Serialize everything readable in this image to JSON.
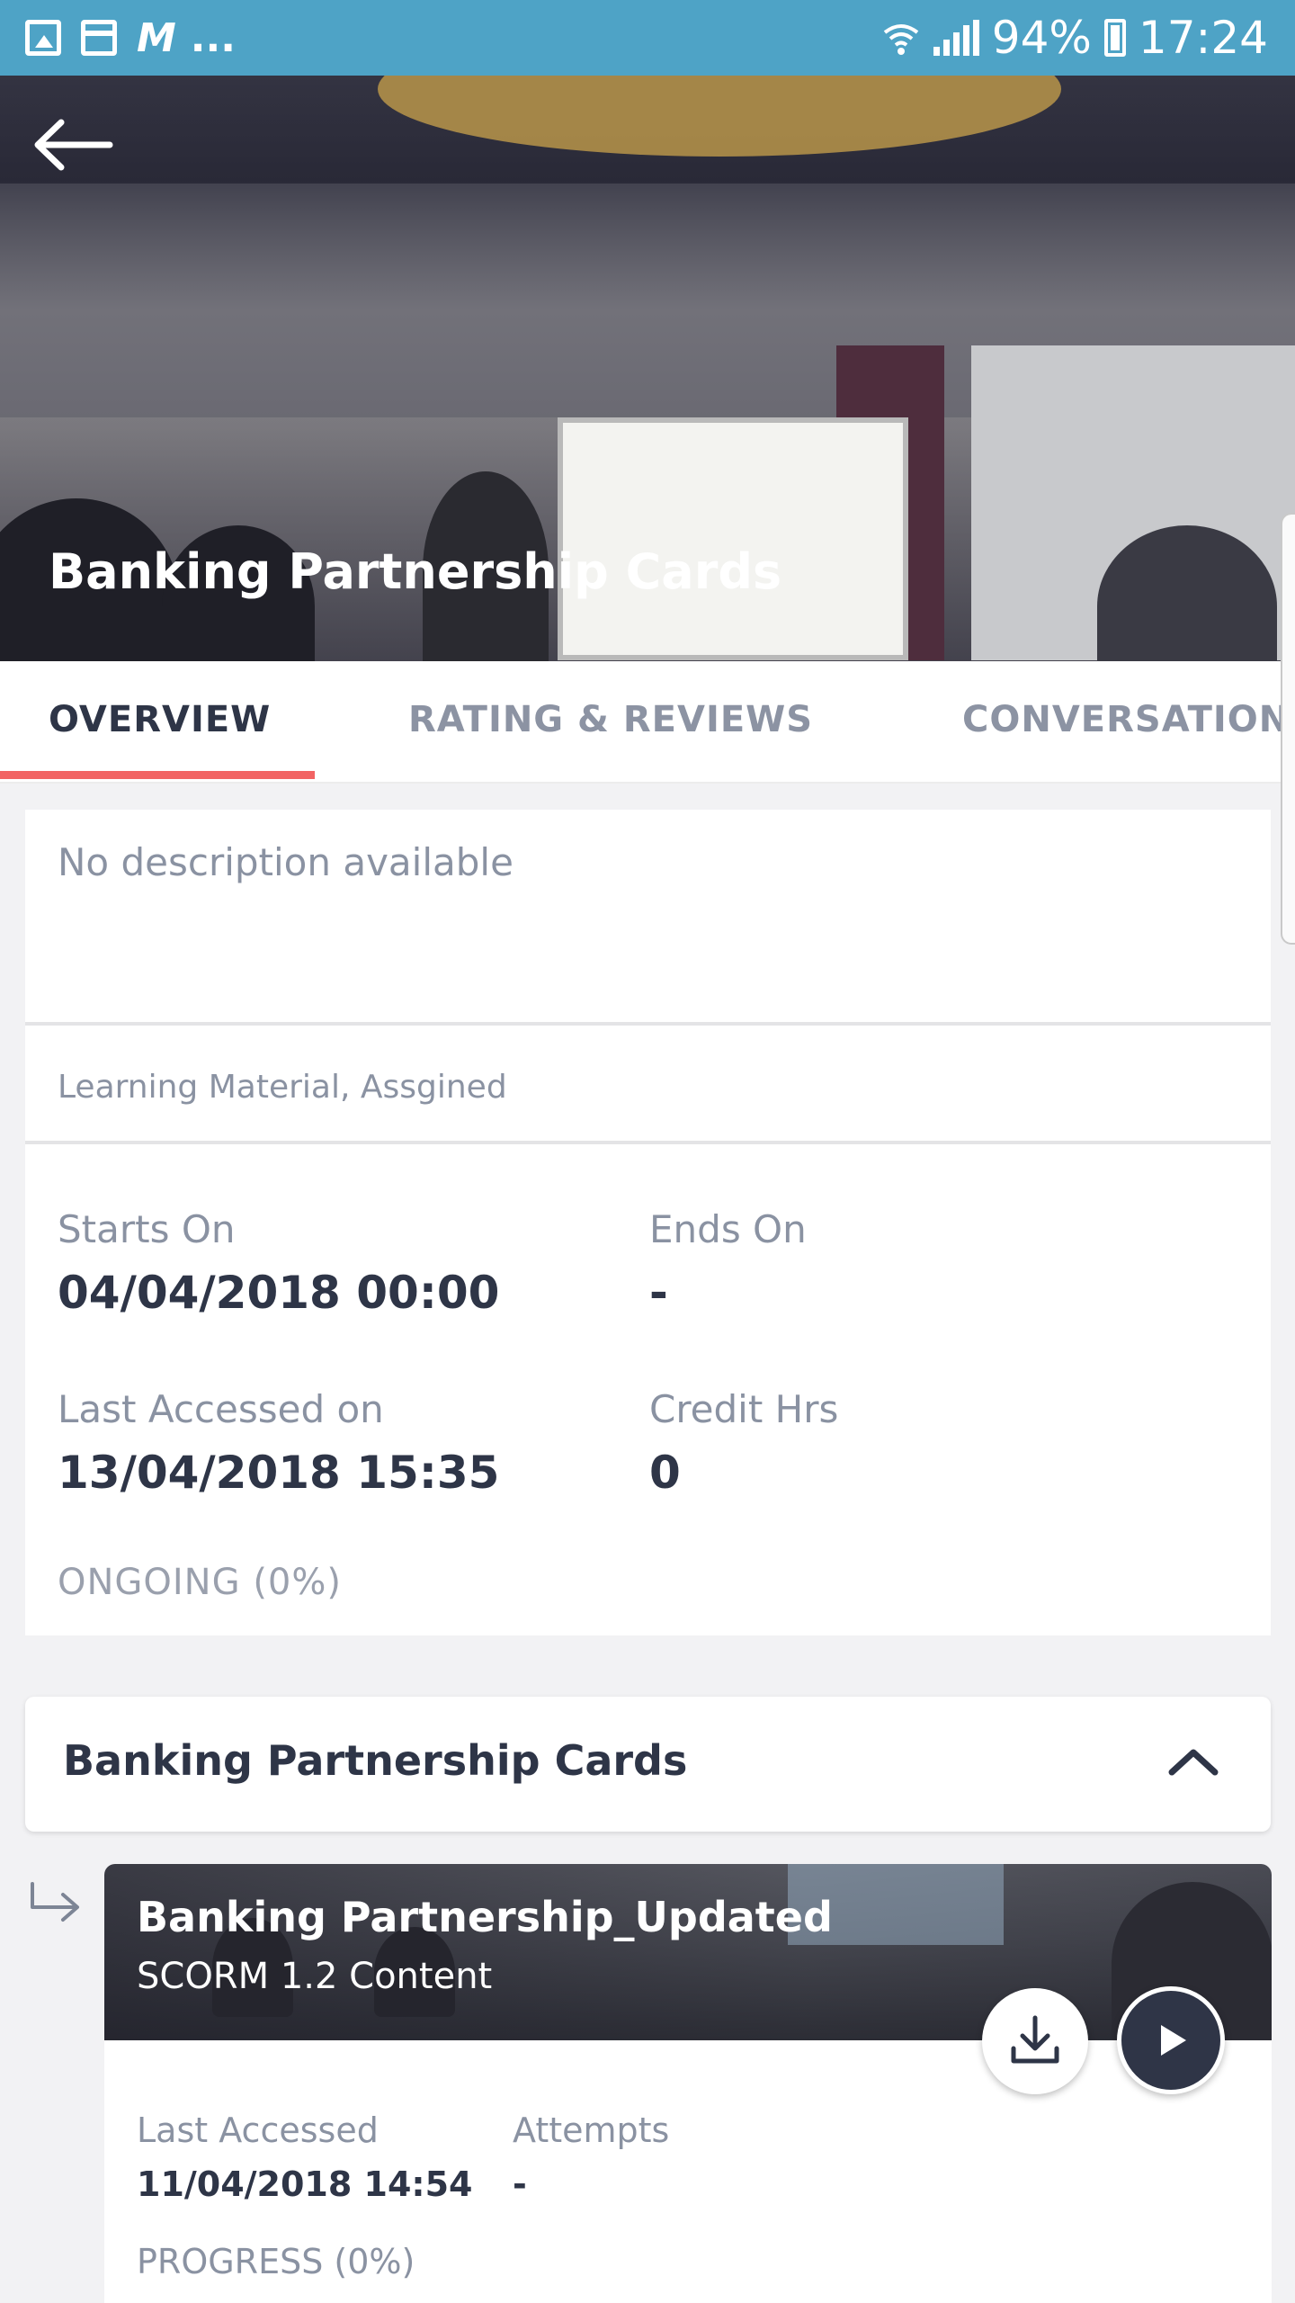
{
  "status_bar": {
    "notification_icons": [
      "image-icon",
      "card-icon",
      "m-icon"
    ],
    "overflow": "...",
    "battery": "94%",
    "time": "17:24"
  },
  "hero": {
    "title": "Banking Partnership Cards"
  },
  "tabs": [
    {
      "label": "OVERVIEW",
      "active": true
    },
    {
      "label": "RATING & REVIEWS",
      "active": false
    },
    {
      "label": "CONVERSATIONS",
      "active": false
    }
  ],
  "overview": {
    "description": "No description available",
    "tags": "Learning Material, Assgined",
    "starts_on_label": "Starts On",
    "starts_on_value": "04/04/2018 00:00",
    "ends_on_label": "Ends On",
    "ends_on_value": "-",
    "last_accessed_label": "Last Accessed on",
    "last_accessed_value": "13/04/2018 15:35",
    "credit_hrs_label": "Credit Hrs",
    "credit_hrs_value": "0",
    "status": "ONGOING (0%)"
  },
  "module": {
    "title": "Banking Partnership Cards",
    "expanded": true
  },
  "content": {
    "title": "Banking Partnership_Updated",
    "type": "SCORM 1.2 Content",
    "last_accessed_label": "Last Accessed",
    "last_accessed_value": "11/04/2018 14:54",
    "attempts_label": "Attempts",
    "attempts_value": "-",
    "progress": "PROGRESS (0%)",
    "progress_value": 0
  },
  "colors": {
    "status_bar": "#4ea3c6",
    "tab_accent": "#f26363",
    "text_dark": "#2e3547",
    "text_muted": "#8a92a2"
  }
}
